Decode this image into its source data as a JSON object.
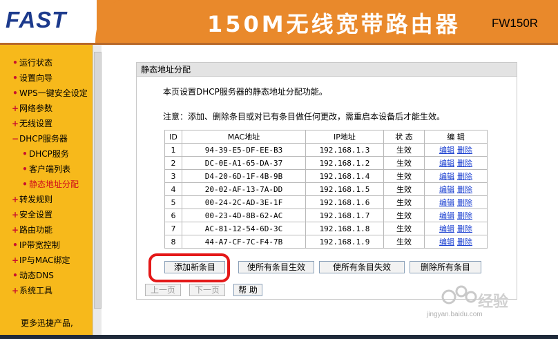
{
  "header": {
    "logo": "FAST",
    "title": "150M无线宽带路由器",
    "model": "FW150R"
  },
  "sidebar": {
    "items": [
      {
        "label": "运行状态",
        "bullet": "•"
      },
      {
        "label": "设置向导",
        "bullet": "•"
      },
      {
        "label": "WPS一键安全设定",
        "bullet": "•"
      },
      {
        "label": "网络参数",
        "bullet": "+"
      },
      {
        "label": "无线设置",
        "bullet": "+"
      },
      {
        "label": "DHCP服务器",
        "bullet": "−"
      },
      {
        "label": "DHCP服务",
        "bullet": "•"
      },
      {
        "label": "客户端列表",
        "bullet": "•"
      },
      {
        "label": "静态地址分配",
        "bullet": "•"
      },
      {
        "label": "转发规则",
        "bullet": "+"
      },
      {
        "label": "安全设置",
        "bullet": "+"
      },
      {
        "label": "路由功能",
        "bullet": "+"
      },
      {
        "label": "IP带宽控制",
        "bullet": "•"
      },
      {
        "label": "IP与MAC绑定",
        "bullet": "+"
      },
      {
        "label": "动态DNS",
        "bullet": "•"
      },
      {
        "label": "系统工具",
        "bullet": "+"
      }
    ],
    "more": "更多迅捷产品,"
  },
  "panel": {
    "title": "静态地址分配",
    "description": "本页设置DHCP服务器的静态地址分配功能。",
    "note": "注意：添加、删除条目或对已有条目做任何更改，需重启本设备后才能生效。",
    "columns": [
      "ID",
      "MAC地址",
      "IP地址",
      "状 态",
      "编 辑"
    ],
    "edit_label": "编辑",
    "delete_label": "删除",
    "rows": [
      {
        "id": "1",
        "mac": "94-39-E5-DF-EE-B3",
        "ip": "192.168.1.3",
        "status": "生效"
      },
      {
        "id": "2",
        "mac": "DC-0E-A1-65-DA-37",
        "ip": "192.168.1.2",
        "status": "生效"
      },
      {
        "id": "3",
        "mac": "D4-20-6D-1F-4B-9B",
        "ip": "192.168.1.4",
        "status": "生效"
      },
      {
        "id": "4",
        "mac": "20-02-AF-13-7A-DD",
        "ip": "192.168.1.5",
        "status": "生效"
      },
      {
        "id": "5",
        "mac": "00-24-2C-AD-3E-1F",
        "ip": "192.168.1.6",
        "status": "生效"
      },
      {
        "id": "6",
        "mac": "00-23-4D-8B-62-AC",
        "ip": "192.168.1.7",
        "status": "生效"
      },
      {
        "id": "7",
        "mac": "AC-81-12-54-6D-3C",
        "ip": "192.168.1.8",
        "status": "生效"
      },
      {
        "id": "8",
        "mac": "44-A7-CF-7C-F4-7B",
        "ip": "192.168.1.9",
        "status": "生效"
      }
    ],
    "buttons": {
      "add": "添加新条目",
      "enable_all": "使所有条目生效",
      "disable_all": "使所有条目失效",
      "delete_all": "删除所有条目",
      "prev": "上一页",
      "next": "下一页",
      "help": "帮 助"
    }
  },
  "watermark": {
    "text": "jingyan.baidu.com"
  },
  "colors": {
    "header": "#e9892b",
    "sidebar": "#f7b91b",
    "logo": "#1c3a8c",
    "link": "#1a3fd0",
    "highlight": "#e41818"
  }
}
